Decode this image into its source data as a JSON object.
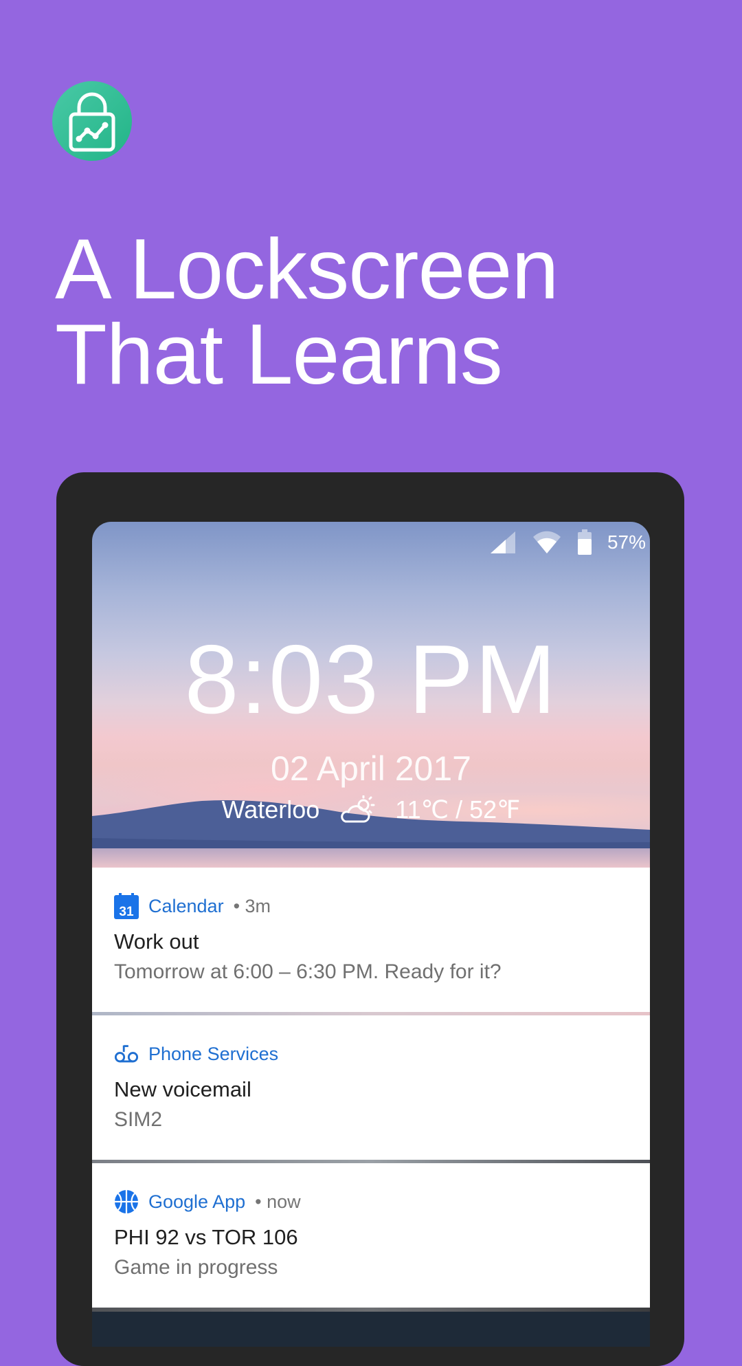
{
  "headline": {
    "line1": "A Lockscreen",
    "line2": "That Learns"
  },
  "status_bar": {
    "battery_percent": "57%"
  },
  "lockscreen": {
    "time": "8:03 PM",
    "date": "02 April 2017",
    "location": "Waterloo",
    "temperature": "11℃ / 52℉",
    "weather_icon": "partly-cloudy-icon"
  },
  "notifications": [
    {
      "icon": "calendar-icon",
      "icon_text": "31",
      "app": "Calendar",
      "time": "• 3m",
      "title": "Work out",
      "body": "Tomorrow at 6:00 – 6:30 PM. Ready for it?"
    },
    {
      "icon": "voicemail-icon",
      "app": "Phone Services",
      "time": "",
      "title": "New voicemail",
      "body": "SIM2"
    },
    {
      "icon": "basketball-icon",
      "app": "Google App",
      "time": "• now",
      "title": "PHI 92 vs TOR 106",
      "body": "Game in progress"
    }
  ],
  "colors": {
    "background": "#9466e0",
    "app_icon": "#2bb98f",
    "accent_blue": "#1f6fd1",
    "phone_frame": "#262626"
  }
}
